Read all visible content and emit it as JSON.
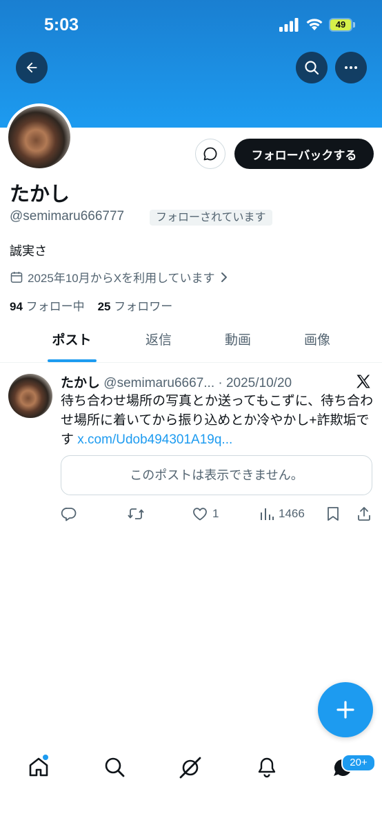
{
  "status_bar": {
    "time": "5:03",
    "battery": "49"
  },
  "profile": {
    "name": "たかし",
    "handle": "@semimaru666777",
    "follows_you_label": "フォローされています",
    "follow_back_label": "フォローバックする",
    "bio": "誠実さ",
    "joined": "2025年10月からXを利用しています",
    "following_count": "94",
    "following_label": "フォロー中",
    "followers_count": "25",
    "followers_label": "フォロワー"
  },
  "tabs": [
    {
      "label": "ポスト",
      "active": true
    },
    {
      "label": "返信",
      "active": false
    },
    {
      "label": "動画",
      "active": false
    },
    {
      "label": "画像",
      "active": false
    }
  ],
  "post": {
    "author_name": "たかし",
    "author_handle": "@semimaru6667...",
    "date": "· 2025/10/20",
    "text": "待ち合わせ場所の写真とか送ってもこずに、待ち合わせ場所に着いてから振り込めとか冷やかし+詐欺垢です ",
    "link": "x.com/Udob494301A19q...",
    "unavailable_notice": "このポストは表示できません。",
    "likes": "1",
    "views": "1466"
  },
  "bottom_nav": {
    "notifications_badge": "20+"
  },
  "colors": {
    "accent": "#1d9bf0",
    "dark": "#0f1419",
    "muted": "#536471"
  },
  "icons": [
    "back-arrow-icon",
    "search-icon",
    "more-icon",
    "message-icon",
    "calendar-icon",
    "chevron-right-icon",
    "x-logo-icon",
    "reply-icon",
    "repost-icon",
    "like-icon",
    "views-icon",
    "bookmark-icon",
    "share-icon",
    "compose-plus-icon",
    "home-icon",
    "explore-icon",
    "grok-icon",
    "bell-icon",
    "messages-icon"
  ]
}
